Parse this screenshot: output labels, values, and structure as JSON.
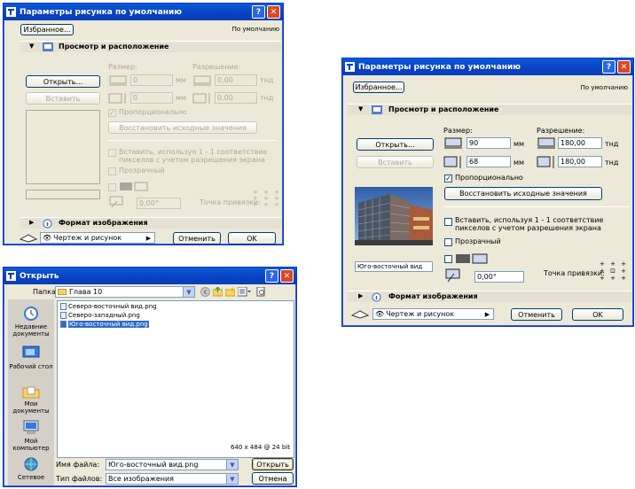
{
  "dialog_left": {
    "title": "Параметры рисунка по умолчанию",
    "favorites": "Избранное...",
    "default_label": "По умолчанию",
    "section_view": "Просмотр и расположение",
    "open_btn": "Открыть...",
    "insert_btn": "Вставить",
    "size_label": "Размер:",
    "resolution_label": "Разрешение:",
    "width": "0",
    "height": "0",
    "unit_mm": "мм",
    "res1": "0,00",
    "res2": "0,00",
    "unit_dpi": "тнд",
    "proportional": "Пропорционально",
    "restore": "Восстановить исходные значения",
    "insert_pixels": "Вставить, используя 1 - 1 соответствие пикселов с учетом разрешения экрана",
    "transparent": "Прозрачный",
    "angle": "0,00°",
    "anchor_label": "Точка привязки:",
    "section_format": "Формат изображения",
    "layer": "Чертеж и рисунок",
    "cancel": "Отменить",
    "ok": "OK"
  },
  "dialog_right": {
    "title": "Параметры рисунка по умолчанию",
    "favorites": "Избранное...",
    "default_label": "По умолчанию",
    "section_view": "Просмотр и расположение",
    "open_btn": "Открыть...",
    "insert_btn": "Вставить",
    "size_label": "Размер:",
    "resolution_label": "Разрешение:",
    "width": "90",
    "height": "68",
    "unit_mm": "мм",
    "res1": "180,00",
    "res2": "180,00",
    "unit_dpi": "тнд",
    "proportional": "Пропорционально",
    "restore": "Восстановить исходные значения",
    "insert_pixels": "Вставить, используя 1 - 1 соответствие пикселов с учетом разрешения экрана",
    "transparent": "Прозрачный",
    "preview_name": "Юго-восточный вид",
    "angle": "0,00°",
    "anchor_label": "Точка привязки:",
    "section_format": "Формат изображения",
    "layer": "Чертеж и рисунок",
    "cancel": "Отменить",
    "ok": "OK"
  },
  "dialog_open": {
    "title": "Открыть",
    "folder_label": "Папка:",
    "folder_value": "Глава 10",
    "places": [
      "Недавние документы",
      "Рабочий стол",
      "Мои документы",
      "Мой компьютер",
      "Сетевое"
    ],
    "files": [
      "Северо-восточный вид.png",
      "Северо-западный.png",
      "Юго-восточный вид.png"
    ],
    "image_info": "640 x 484 @ 24 bit",
    "filename_label": "Имя файла:",
    "filename_value": "Юго-восточный вид.png",
    "filetype_label": "Тип файлов:",
    "filetype_value": "Все изображения",
    "open_btn": "Открыть",
    "cancel_btn": "Отмена"
  },
  "icons": {
    "help": "?",
    "close": "✕",
    "check": "✓",
    "triangle_down": "▼",
    "triangle_right": "▶"
  }
}
